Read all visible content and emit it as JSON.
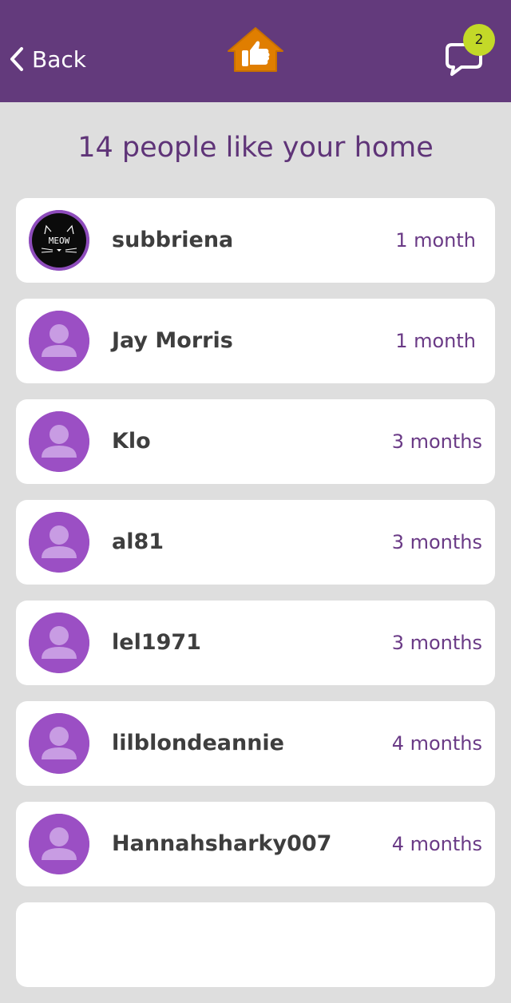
{
  "header": {
    "back_label": "Back",
    "center_icon": "home-like-icon",
    "chat_icon": "chat-bubble-icon",
    "chat_badge_count": "2",
    "background_color": "#633a7c",
    "badge_color": "#c3d928",
    "home_icon_color": "#e07e00"
  },
  "page_title": "14 people like your home",
  "likes": [
    {
      "username": "subbriena",
      "time": "1 month",
      "avatar": "photo",
      "avatar_text": "MEOW"
    },
    {
      "username": "Jay Morris",
      "time": "1 month",
      "avatar": "default"
    },
    {
      "username": "Klo",
      "time": "3 months",
      "avatar": "default"
    },
    {
      "username": "al81",
      "time": "3 months",
      "avatar": "default"
    },
    {
      "username": "lel1971",
      "time": "3 months",
      "avatar": "default"
    },
    {
      "username": "lilblondeannie",
      "time": "4 months",
      "avatar": "default"
    },
    {
      "username": "Hannahsharky007",
      "time": "4 months",
      "avatar": "default"
    }
  ]
}
